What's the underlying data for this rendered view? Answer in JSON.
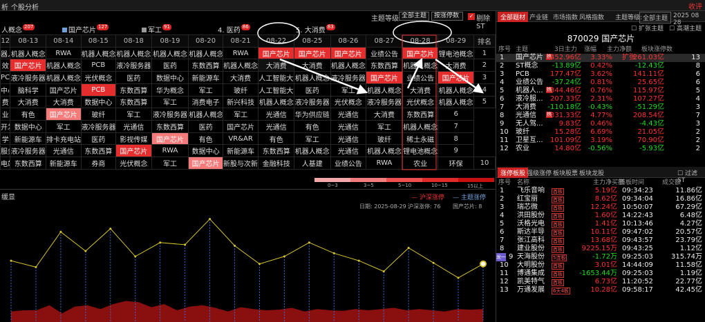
{
  "top": {
    "tabs": [
      "析",
      "个股分析"
    ],
    "close": "收评"
  },
  "toolbar": {
    "level_label": "主题等级:",
    "level_value": "全部主题",
    "sort_value": "按涨停数",
    "filter_label": "剔除ST",
    "check": "✓"
  },
  "hot": [
    {
      "label": "人概念",
      "count": "207",
      "color": ""
    },
    {
      "label": "国产芯片",
      "count": "127",
      "color": "#6fa0d8"
    },
    {
      "label": "军工",
      "count": "91",
      "color": "#aaa"
    },
    {
      "label": "4. 医药",
      "count": "86",
      "color": ""
    },
    {
      "label": "5. 大消费",
      "count": "83",
      "color": ""
    }
  ],
  "grid": {
    "headers": [
      "12",
      "08-13",
      "08-14",
      "08-15",
      "08-18",
      "08-19",
      "08-20",
      "08-21",
      "08-22",
      "08-25",
      "08-26",
      "08-27",
      "08-28",
      "08-29",
      "排名"
    ],
    "rows": [
      [
        "器人概念",
        "机器人概念",
        "RWA",
        "机器人概念",
        "机器人概念",
        "机器人概念",
        "机器人概念",
        "RWA",
        "国产芯片",
        "国产芯片",
        "国产芯片",
        "业绩公告",
        "国产芯片",
        "锂电池概念",
        "1"
      ],
      [
        "效",
        "国产芯片",
        "机器人概念",
        "PCB",
        "液冷服务器",
        "医药",
        "东数西算",
        "机器人概念",
        "大消费",
        "大消费",
        "机器人概念",
        "东数西算",
        "机器人概念",
        "大消费",
        "2"
      ],
      [
        "PCB",
        "液冷服务器",
        "机器人概念",
        "光伏概念",
        "医药",
        "数据中心",
        "新能源车",
        "大消费",
        "人工智能大模型",
        "机器人概念",
        "液冷服务器",
        "国产芯片",
        "业绩公告",
        "国产芯片",
        "3"
      ],
      [
        "中心",
        "脑科学",
        "国产芯片",
        "PCB",
        "东数西算",
        "华为概念",
        "军工",
        "玻纤",
        "人工智能大模型",
        "医药",
        "军工",
        "机器人概念",
        "大消费",
        "机器人概念",
        "4"
      ],
      [
        "费",
        "大消费",
        "大消费",
        "数据中心",
        "东数西算",
        "军工",
        "消费电子",
        "新兴科技",
        "机器人概念",
        "液冷服务器",
        "光伏概念",
        "液冷服务器",
        "光伏概念",
        "机器人概念",
        "5"
      ],
      [
        "业",
        "有色",
        "国产芯片",
        "玻纤",
        "军工",
        "液冷服务器",
        "机器人概念",
        "军工",
        "光通信",
        "华为供应链",
        "光通信",
        "大消费",
        "东数西算",
        "6"
      ],
      [
        "开发",
        "数据中心",
        "军工",
        "液冷服务器",
        "光通信",
        "东数西算",
        "医药",
        "国产芯片",
        "光通信",
        "有色",
        "光通信",
        "军工",
        "机器人概念",
        "7"
      ],
      [
        "学",
        "新能源车",
        "排卡充电站",
        "医药",
        "影视传媒",
        "国产芯片",
        "有色",
        "VR&AR",
        "有色",
        "军工",
        "光通信",
        "玻纤",
        "稀土永磁",
        "8"
      ],
      [
        "服务器",
        "液冷服务器",
        "光通信",
        "东数西算",
        "国产芯片",
        "RWA",
        "数据中心",
        "新能源车",
        "东数西算",
        "机器人概念",
        "光通信",
        "机器人概念",
        "锂电池概念",
        "9"
      ],
      [
        "电站",
        "东数西算",
        "新能源车",
        "券商",
        "光伏概念",
        "军工",
        "国产芯片",
        "新股与次新股",
        "金融科技",
        "人基建",
        "业绩公告",
        "RWA",
        "农业",
        "环保",
        "10"
      ]
    ]
  },
  "legend": {
    "labels": [
      "0~3",
      "3~5",
      "5~10",
      "10~15",
      "15以上"
    ],
    "colors": [
      "#f3a9a9",
      "#f27d7d",
      "#ee4f4f",
      "#e02b2b",
      "#c81010"
    ]
  },
  "chart": {
    "title": "缓显",
    "legend_a": "沪深涨停",
    "legend_b": "主题涨停",
    "date_label": "日期: 2025-08-29",
    "zt_label": "沪深涨停: 76",
    "theme_label": "国产芯片: 8"
  },
  "chart_data": {
    "type": "line",
    "series": [
      {
        "name": "沪深涨停",
        "values": [
          18,
          20,
          20,
          28,
          15,
          26,
          28,
          22,
          30,
          35,
          33,
          25,
          30,
          20,
          26,
          28,
          24,
          18,
          25,
          22,
          20,
          21,
          24,
          18,
          22,
          20,
          19,
          22,
          20,
          22,
          24,
          20,
          22,
          20,
          18,
          22,
          21,
          22
        ]
      },
      {
        "name": "主题涨停",
        "values": [
          58,
          52,
          85,
          67,
          88,
          62,
          75,
          73,
          97,
          72,
          55,
          62,
          75,
          65,
          58,
          48,
          70,
          56,
          42,
          55
        ]
      }
    ]
  },
  "right": {
    "tabs1": [
      "全部题材",
      "产业链",
      "市场指数",
      "风格指数"
    ],
    "theme_label": "主题等级:",
    "theme_value": "全部主题",
    "date": "2025 08 28",
    "chk1": "扩张主题",
    "chk2": "高潮主题",
    "code": "870029 国产芯片",
    "headers1": [
      "序号",
      "主题",
      "3日主力",
      "涨幅",
      "主力净额",
      "板块涨停数"
    ],
    "rows1": [
      {
        "n": "1",
        "name": "国产芯片",
        "tag": "热",
        "a": "452.96亿",
        "b": "3.33%",
        "c": "扩张",
        "d": "261.03亿",
        "e": "13",
        "cls": "sel"
      },
      {
        "n": "2",
        "name": "ST概念",
        "a": "-13.89亿",
        "b": "0.42%",
        "d": "-12.43亿",
        "e": "8"
      },
      {
        "n": "3",
        "name": "PCB",
        "a": "177.47亿",
        "b": "3.62%",
        "d": "141.11亿",
        "e": "6"
      },
      {
        "n": "4",
        "name": "业绩公告",
        "a": "-37.24亿",
        "b": "0.81%",
        "d": "25.65亿",
        "e": "6"
      },
      {
        "n": "5",
        "name": "机器人...",
        "tag": "热",
        "a": "344.46亿",
        "b": "0.76%",
        "d": "115.97亿",
        "e": "5"
      },
      {
        "n": "6",
        "name": "液冷服...",
        "a": "207.33亿",
        "b": "2.31%",
        "d": "107.27亿",
        "e": "4"
      },
      {
        "n": "7",
        "name": "大消费",
        "a": "-110.18亿",
        "b": "-0.43%",
        "d": "-51.29亿",
        "e": "3"
      },
      {
        "n": "8",
        "name": "光通信",
        "tag": "热",
        "a": "331.33亿",
        "b": "4.77%",
        "d": "208.54亿",
        "e": "7"
      },
      {
        "n": "9",
        "name": "无人驾...",
        "a": "9.83亿",
        "b": "0.46%",
        "d": "-4.43亿",
        "e": "3"
      },
      {
        "n": "10",
        "name": "玻纤",
        "a": "15.28亿",
        "b": "6.69%",
        "d": "21.05亿",
        "e": "2"
      },
      {
        "n": "11",
        "name": "卫星互...",
        "a": "101.09亿",
        "b": "3.19%",
        "d": "70.90亿",
        "e": "2"
      },
      {
        "n": "12",
        "name": "农业",
        "a": "14.80亿",
        "b": "-0.56%",
        "d": "-5.93亿",
        "e": "2"
      }
    ],
    "tabs2": [
      "涨停板股",
      "强级涨停",
      "板块股票",
      "板块龙股"
    ],
    "filter2": "过滤ST",
    "headers2": [
      "序号",
      "名称",
      "",
      "主力净买额",
      "首板时间",
      "成交额"
    ],
    "rows2": [
      {
        "n": "1",
        "name": "飞乐音响",
        "tag": "首板",
        "a": "5.19亿",
        "t": "09:34:23",
        "v": "11.86亿"
      },
      {
        "n": "2",
        "name": "红宝丽",
        "tag": "首板",
        "a": "8.62亿",
        "t": "09:34:04",
        "v": "16.86亿"
      },
      {
        "n": "3",
        "name": "瑞芯微",
        "tag": "首板",
        "a": "12.24亿",
        "t": "10:50:07",
        "v": "67.29亿"
      },
      {
        "n": "4",
        "name": "洪田股份",
        "tag": "首板",
        "a": "1.60亿",
        "t": "14:22:43",
        "v": "6.48亿"
      },
      {
        "n": "5",
        "name": "沃格光电",
        "tag": "首板",
        "a": "1.41亿",
        "t": "10:13:46",
        "v": "4.27亿"
      },
      {
        "n": "6",
        "name": "斯达半导",
        "tag": "首板",
        "a": "10.11亿",
        "t": "09:47:02",
        "v": "20.57亿"
      },
      {
        "n": "7",
        "name": "张江高科",
        "tag": "首板",
        "a": "13.68亿",
        "t": "09:43:57",
        "v": "23.79亿"
      },
      {
        "n": "8",
        "name": "建业股份",
        "tag": "首板",
        "a": "9225.15万",
        "t": "09:43:25",
        "v": "1.12亿"
      },
      {
        "n": "9",
        "name": "天海股份",
        "tag": "5连板",
        "a": "-1.72万",
        "t": "09:25:03",
        "v": "315.74万",
        "pre": "龙一"
      },
      {
        "n": "10",
        "name": "大明股份",
        "tag": "首板",
        "a": "3.01亿",
        "t": "14:44:09",
        "v": "11.58亿"
      },
      {
        "n": "11",
        "name": "博通集成",
        "tag": "首板",
        "a": "-1653.44万",
        "t": "09:25:03",
        "v": "1.19亿"
      },
      {
        "n": "12",
        "name": "凯美特气",
        "tag": "首板",
        "a": "6.73亿",
        "t": "11:20:52",
        "v": "22.77亿"
      },
      {
        "n": "13",
        "name": "万通发展",
        "tag": "6天4板",
        "a": "10.28亿",
        "t": "09:58:17",
        "v": "42.45亿"
      }
    ]
  }
}
